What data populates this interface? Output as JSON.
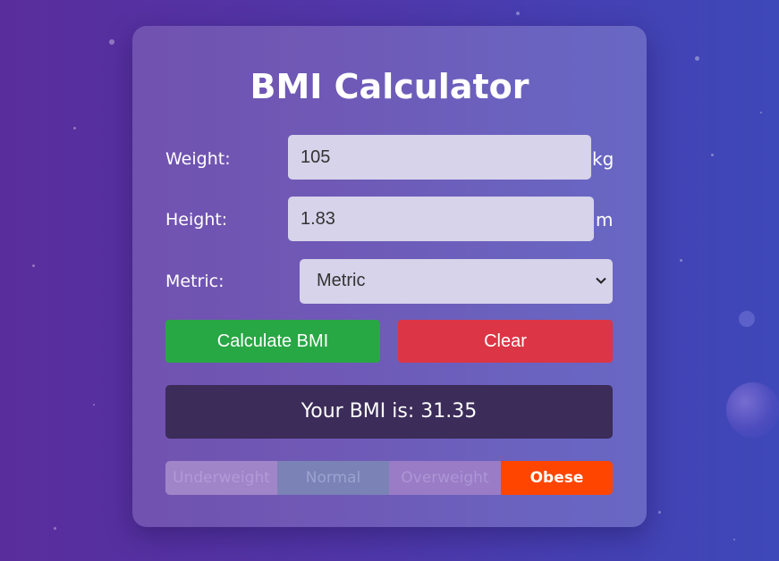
{
  "title": "BMI Calculator",
  "form": {
    "weight": {
      "label": "Weight:",
      "value": "105",
      "unit": "kg"
    },
    "height": {
      "label": "Height:",
      "value": "1.83",
      "unit": "m"
    },
    "metric": {
      "label": "Metric:",
      "selected": "Metric"
    }
  },
  "buttons": {
    "calculate": "Calculate BMI",
    "clear": "Clear"
  },
  "result": "Your BMI is: 31.35",
  "scale": {
    "categories": [
      "Underweight",
      "Normal",
      "Overweight",
      "Obese"
    ],
    "active": "Obese"
  },
  "colors": {
    "calculate": "#28a745",
    "clear": "#dc3545",
    "obese": "#ff4500"
  },
  "icons": {
    "select": "chevron-down-icon"
  }
}
